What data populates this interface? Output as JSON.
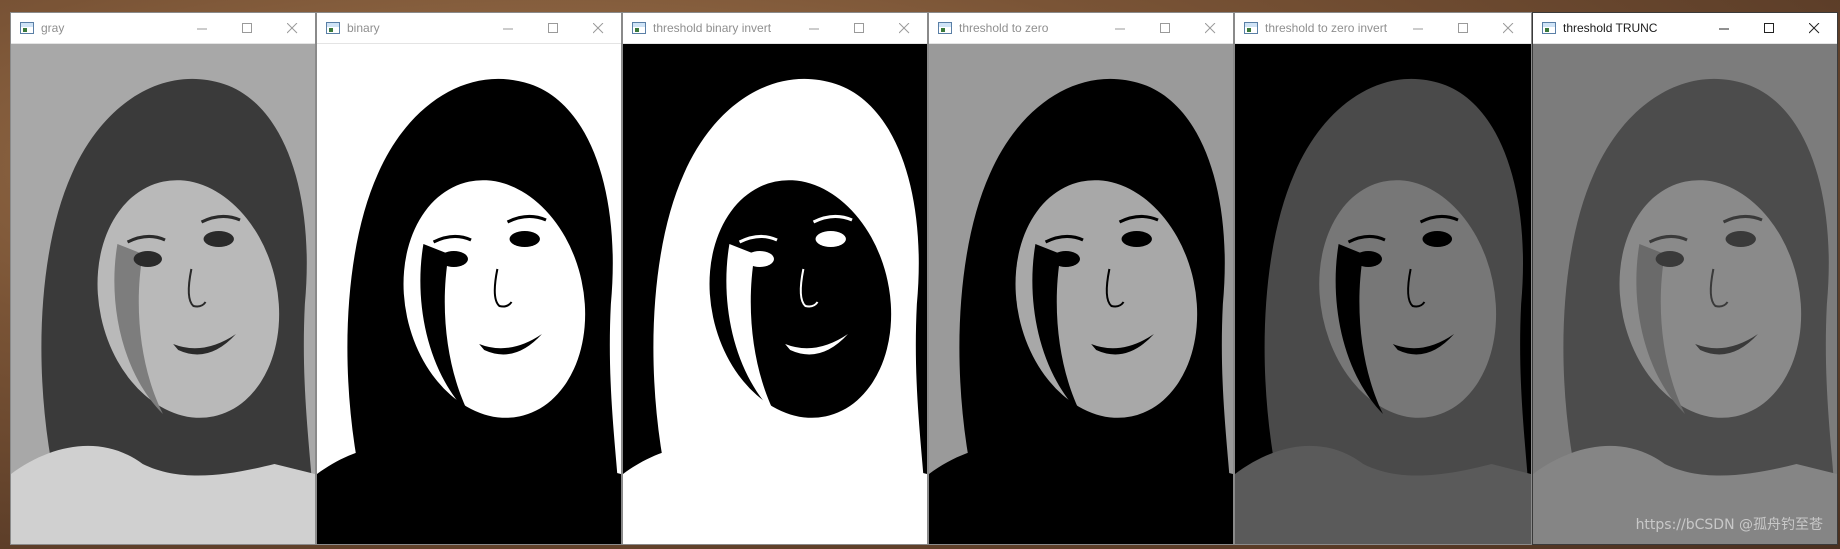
{
  "windows": [
    {
      "title": "gray",
      "mode": "gray",
      "active": false
    },
    {
      "title": "binary",
      "mode": "binary",
      "active": false
    },
    {
      "title": "threshold binary invert",
      "mode": "binary-inv",
      "active": false
    },
    {
      "title": "threshold to zero",
      "mode": "tozero",
      "active": false
    },
    {
      "title": "threshold to zero invert",
      "mode": "tozero-inv",
      "active": false
    },
    {
      "title": "threshold TRUNC",
      "mode": "trunc",
      "active": true
    }
  ],
  "window_controls": {
    "minimize_icon": "minimize-icon",
    "maximize_icon": "maximize-icon",
    "close_icon": "close-icon"
  },
  "watermark": "https://bCSDN @孤舟钓至苍",
  "colors": {
    "desktop": "#7a5436",
    "titlebar": "#ffffff",
    "inactive_title": "#8f8f8f",
    "active_title": "#1a1a1a"
  }
}
